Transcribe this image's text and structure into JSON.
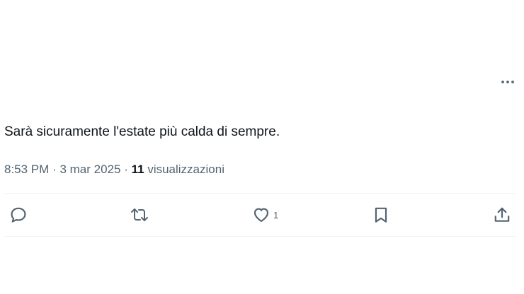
{
  "tweet": {
    "text": "Sarà sicuramente l'estate più calda di sempre.",
    "time": "8:53 PM",
    "separator": "·",
    "date": "3 mar 2025",
    "views_count": "11",
    "views_label": "visualizzazioni"
  },
  "actions": {
    "reply": {
      "icon": "reply-icon"
    },
    "retweet": {
      "icon": "retweet-icon"
    },
    "like": {
      "icon": "heart-icon",
      "count": "1"
    },
    "bookmark": {
      "icon": "bookmark-icon"
    },
    "share": {
      "icon": "share-icon"
    }
  },
  "more": {
    "icon": "more-horizontal-icon"
  },
  "colors": {
    "text": "#0f1419",
    "secondary": "#536471",
    "divider": "#eff3f4"
  }
}
